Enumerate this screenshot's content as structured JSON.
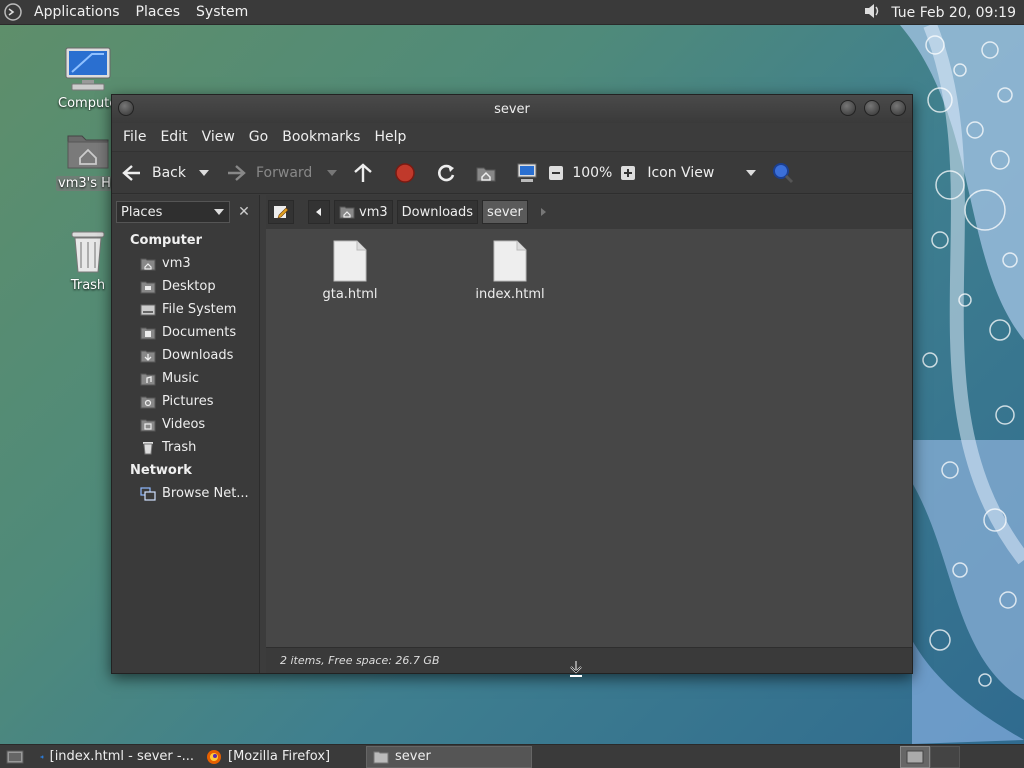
{
  "top_panel": {
    "menus": [
      "Applications",
      "Places",
      "System"
    ],
    "clock": "Tue Feb 20, 09:19"
  },
  "desktop": {
    "icons": [
      {
        "label": "Computer",
        "icon": "computer-icon"
      },
      {
        "label": "vm3's Home",
        "icon": "home-folder-icon"
      },
      {
        "label": "Trash",
        "icon": "trash-icon"
      }
    ]
  },
  "window": {
    "title": "sever",
    "menus": [
      "File",
      "Edit",
      "View",
      "Go",
      "Bookmarks",
      "Help"
    ],
    "toolbar": {
      "back": "Back",
      "forward": "Forward",
      "zoom": "100%",
      "view_mode": "Icon View"
    },
    "sidebar": {
      "selector": "Places",
      "computer_header": "Computer",
      "computer_items": [
        "vm3",
        "Desktop",
        "File System",
        "Documents",
        "Downloads",
        "Music",
        "Pictures",
        "Videos",
        "Trash"
      ],
      "network_header": "Network",
      "network_items": [
        "Browse Net..."
      ]
    },
    "path": [
      "vm3",
      "Downloads",
      "sever"
    ],
    "files": [
      {
        "name": "gta.html",
        "icon": "html-file-icon"
      },
      {
        "name": "index.html",
        "icon": "html-file-icon"
      }
    ],
    "status": "2 items, Free space: 26.7 GB"
  },
  "taskbar": {
    "tasks": [
      "[index.html - sever -...",
      "[Mozilla Firefox]",
      "sever"
    ]
  },
  "colors": {
    "panel": "#3a3a3a",
    "view_bg": "#474747",
    "stop_red": "#c0392b"
  }
}
